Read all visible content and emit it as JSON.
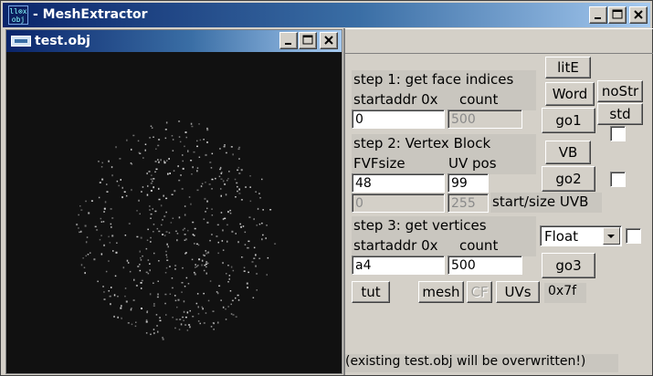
{
  "app": {
    "icon_text": "ll⊗x obj",
    "title": "- MeshExtractor"
  },
  "subwindow": {
    "title": "test.obj"
  },
  "step1": {
    "heading": "step 1: get face indices",
    "label_addr": "startaddr 0x",
    "label_count": "count",
    "addr_value": "0",
    "count_value": "500"
  },
  "step2": {
    "heading": "step 2: Vertex Block",
    "label_fvf": "FVFsize",
    "label_uvpos": "UV pos",
    "fvf_value": "48",
    "uvpos_value": "99",
    "uvb_start_value": "0",
    "uvb_size_value": "255",
    "uvb_label": "start/size UVB"
  },
  "step3": {
    "heading": "step 3: get vertices",
    "label_addr": "startaddr 0x",
    "label_count": "count",
    "addr_value": "a4",
    "count_value": "500",
    "type_selected": "Float"
  },
  "buttons": {
    "lite": "litE",
    "word": "Word",
    "nostr": "noStr",
    "go1": "go1",
    "std": "std",
    "vb": "VB",
    "go2": "go2",
    "go3": "go3",
    "tut": "tut",
    "mesh": "mesh",
    "cf": "CF",
    "uvs": "UVs"
  },
  "hex_readout": "0x7f",
  "footer_note": "(existing test.obj will be overwritten!)",
  "icons": [
    "app-icon",
    "minimize-icon",
    "maximize-icon",
    "close-icon",
    "window-icon",
    "chevron-down-icon"
  ],
  "colors": {
    "titlebar_start": "#0a246a",
    "titlebar_end": "#a6caf0",
    "face": "#d4d0c8",
    "viewport": "#111111"
  }
}
